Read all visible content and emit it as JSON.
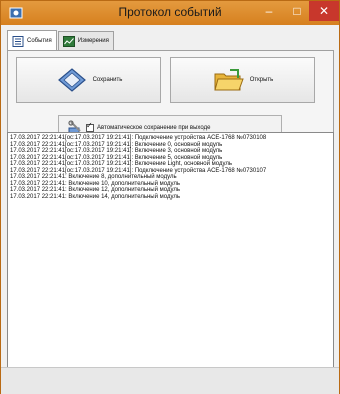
{
  "window": {
    "title": "Протокол событий",
    "minimize": "–",
    "maximize": "□",
    "close": "✕"
  },
  "tabs": [
    {
      "label": "События",
      "icon": "document-icon"
    },
    {
      "label": "Измерения",
      "icon": "chart-icon"
    }
  ],
  "toolbar": {
    "save_label": "Сохранить",
    "open_label": "Открыть",
    "autosave_label": "Автоматическое сохранение при выходе",
    "autosave_checked": true
  },
  "log": [
    "17.03.2017 22:21:41[oc:17.03.2017 19:21:41]: Подключение устройства ACE-1768 №0730108",
    "17.03.2017 22:21:41[oc:17.03.2017 19:21:41]: Включение 0, основной модуль",
    "17.03.2017 22:21:41[oc:17.03.2017 19:21:41]: Включение 3, основной модуль",
    "17.03.2017 22:21:41[oc:17.03.2017 19:21:41]: Включение 5, основной модуль",
    "17.03.2017 22:21:41[oc:17.03.2017 19:21:41]: Включение Light, основной модуль",
    "17.03.2017 22:21:41[oc:17.03.2017 19:21:41]: Подключение устройства ACE-1768 №0730107",
    "17.03.2017 22:21:41: Включение 8, дополнительный модуль",
    "17.03.2017 22:21:41: Включение 10, дополнительный модуль",
    "17.03.2017 22:21:41: Включение 12, дополнительный модуль",
    "17.03.2017 22:21:41: Включение 14, дополнительный модуль"
  ],
  "colors": {
    "titlebar": "#d6801f",
    "close": "#c8372c"
  }
}
